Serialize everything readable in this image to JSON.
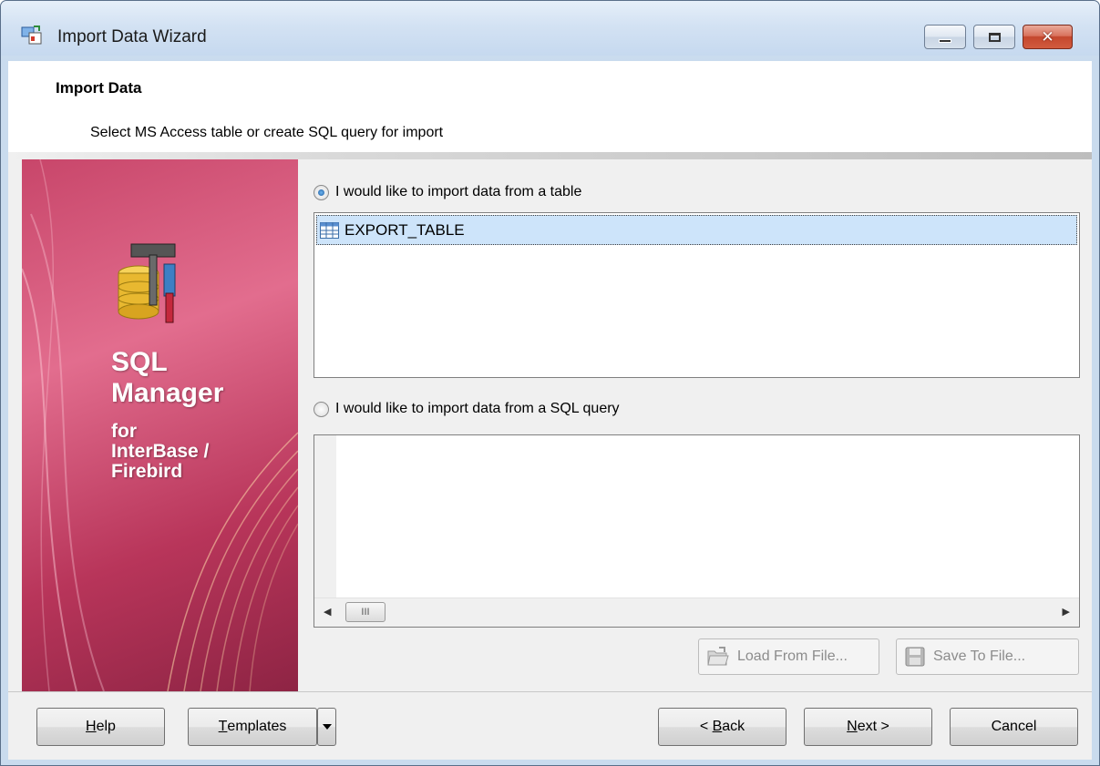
{
  "window": {
    "title": "Import Data Wizard"
  },
  "header": {
    "title": "Import Data",
    "subtitle": "Select MS Access table or create SQL query for import"
  },
  "banner": {
    "line1": "SQL",
    "line2": "Manager",
    "line3": "for",
    "line4": "InterBase /",
    "line5": "Firebird"
  },
  "source": {
    "table_option_label": "I would like to import data from a table",
    "table_option_selected": true,
    "tables": [
      {
        "name": "EXPORT_TABLE",
        "selected": true
      }
    ],
    "query_option_label": "I would like to import data from a SQL query",
    "query_option_selected": false,
    "query_text": "",
    "scroll_thumb_label": "III"
  },
  "query_actions": {
    "load_label": "Load From File...",
    "save_label": "Save To File..."
  },
  "footer": {
    "help": {
      "pre": "",
      "key": "H",
      "post": "elp"
    },
    "templates": {
      "pre": "",
      "key": "T",
      "post": "emplates"
    },
    "back": {
      "pre": "< ",
      "key": "B",
      "post": "ack"
    },
    "next": {
      "pre": "",
      "key": "N",
      "post": "ext >"
    },
    "cancel_label": "Cancel"
  },
  "icons": {
    "app": "import-wizard-icon",
    "banner_logo": "database-tools-icon",
    "table": "table-grid-icon",
    "load": "folder-open-icon",
    "save": "floppy-disk-icon"
  },
  "colors": {
    "banner": "#c8466a",
    "selection": "#cde4fa",
    "close_button": "#c4472e"
  }
}
